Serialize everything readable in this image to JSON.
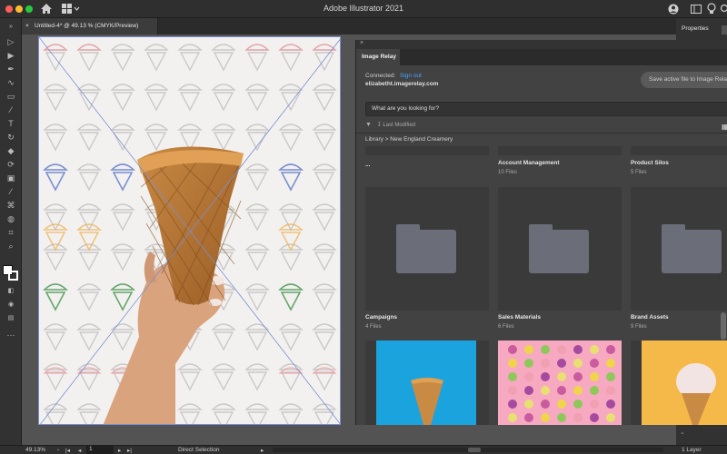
{
  "window": {
    "title": "Adobe Illustrator 2021"
  },
  "document_tab": {
    "close": "×",
    "label": "Untitled-4* @ 49.13 % (CMYK/Preview)"
  },
  "right_panel_tabs": {
    "properties": "Properties"
  },
  "image_relay": {
    "tab": "Image Relay",
    "connected_label": "Connected:",
    "sign_out": "Sign out",
    "email": "elizabetht.imagerelay.com",
    "save_button": "Save active file to Image Relay",
    "search_placeholder": "What are you looking for?",
    "sort_label": "Last Modified",
    "breadcrumb": "Library > New England Creamery",
    "top_items": [
      {
        "title": "...",
        "meta": ""
      },
      {
        "title": "Account Management",
        "meta": "10 Files"
      },
      {
        "title": "Product Silos",
        "meta": "5 Files"
      }
    ],
    "folders": [
      {
        "title": "Campaigns",
        "meta": "4 Files"
      },
      {
        "title": "Sales Materials",
        "meta": "6 Files"
      },
      {
        "title": "Brand Assets",
        "meta": "9 Files"
      }
    ]
  },
  "status_bar": {
    "zoom": "49.13%",
    "page": "1",
    "tool": "Direct Selection",
    "layers": "1 Layer"
  },
  "icons": [
    "apple-window-controls",
    "home-icon",
    "workspace-icon",
    "search-icon",
    "lightbulb-icon"
  ],
  "colors": {
    "accent_link": "#4aa3ff",
    "artboard_guides": "#7a8fd0"
  }
}
